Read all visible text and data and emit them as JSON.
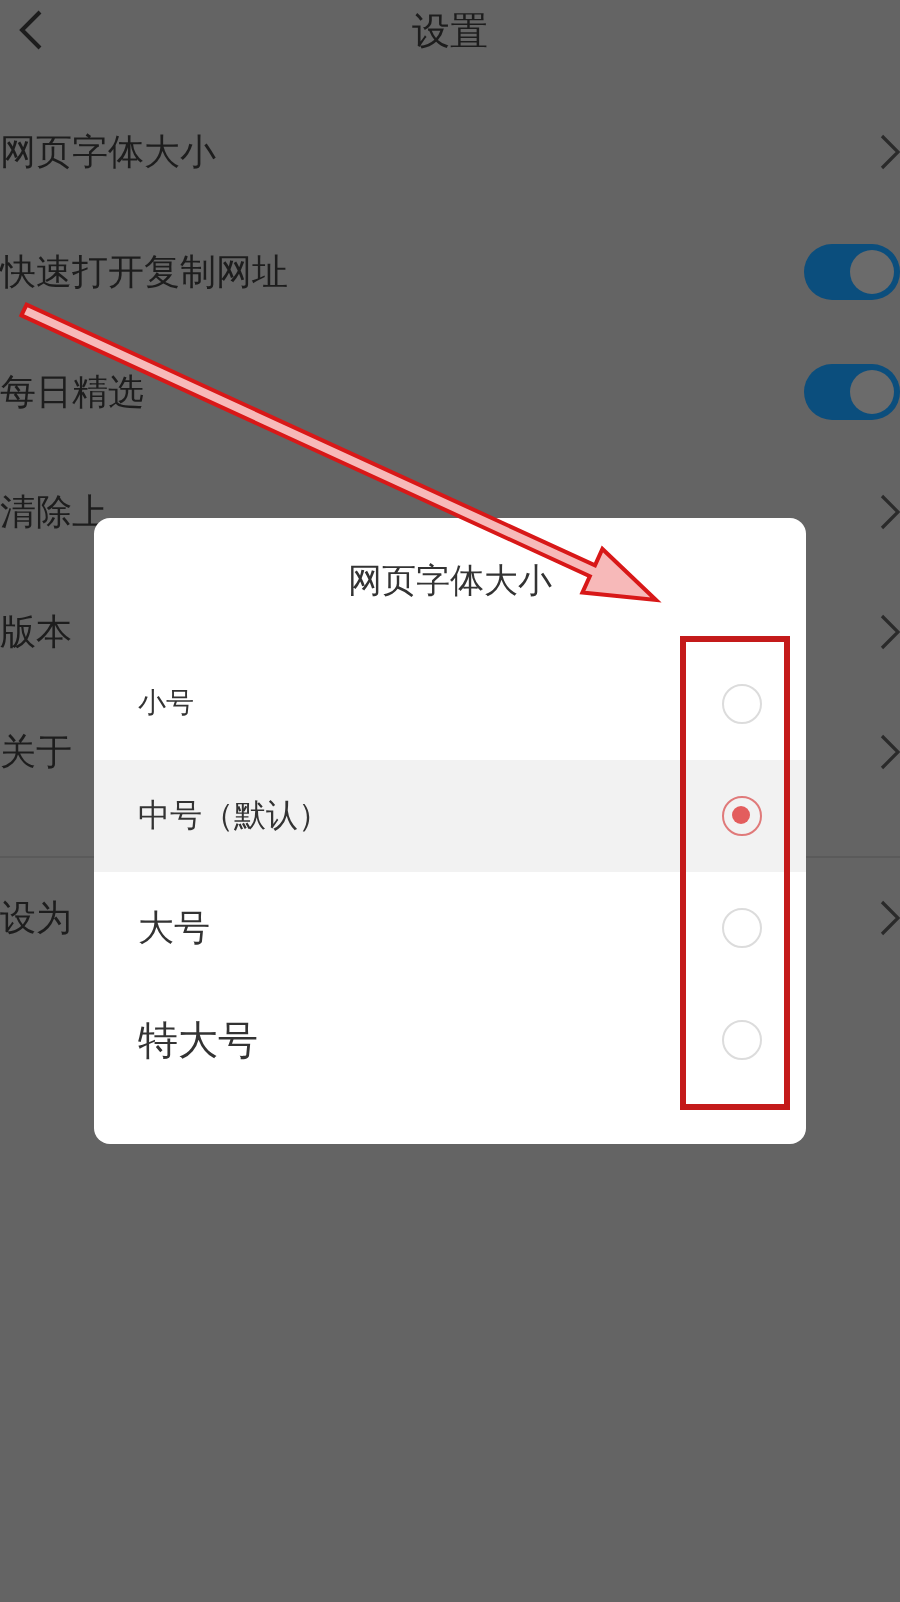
{
  "header": {
    "title": "设置"
  },
  "settings_groups": [
    [
      {
        "label": "网页字体大小",
        "kind": "link"
      },
      {
        "label": "快速打开复制网址",
        "kind": "toggle",
        "on": true
      },
      {
        "label": "每日精选",
        "kind": "toggle",
        "on": true
      },
      {
        "label": "清除上",
        "kind": "link"
      },
      {
        "label": "版本",
        "kind": "link"
      },
      {
        "label": "关于",
        "kind": "link"
      }
    ],
    [
      {
        "label": "设为",
        "kind": "link"
      }
    ]
  ],
  "dialog": {
    "title": "网页字体大小",
    "options": [
      {
        "label": "小号",
        "selected": false
      },
      {
        "label": "中号（默认）",
        "selected": true
      },
      {
        "label": "大号",
        "selected": false
      },
      {
        "label": "特大号",
        "selected": false
      }
    ]
  }
}
